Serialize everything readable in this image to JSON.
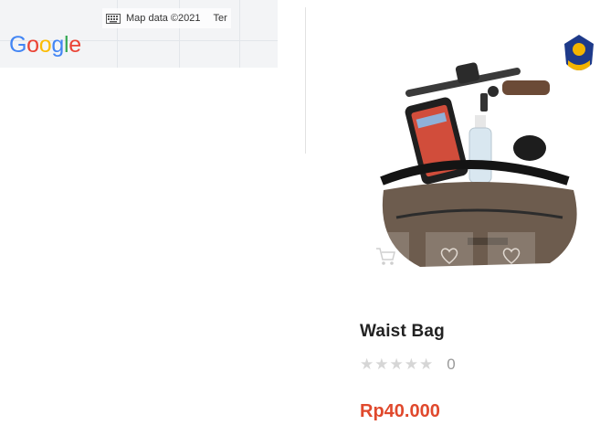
{
  "map": {
    "logo": [
      "G",
      "o",
      "o",
      "g",
      "l",
      "e"
    ],
    "attribution": "Map data ©2021",
    "terms": "Ter"
  },
  "product": {
    "name": "Waist Bag",
    "stars": "★★★★★",
    "rating_value": 0,
    "rating_count": "0",
    "price": "Rp40.000",
    "accent_color": "#e0492d",
    "icons": [
      "cart-icon",
      "heart-icon",
      "heart-icon",
      "brand-logo"
    ]
  }
}
